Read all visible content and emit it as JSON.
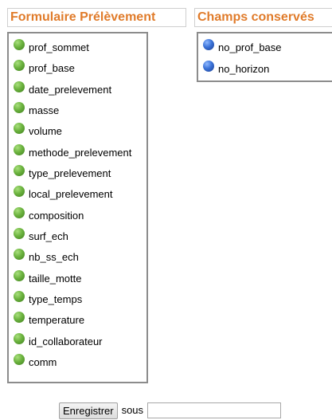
{
  "left_panel": {
    "title": "Formulaire Prélèvement",
    "fields": [
      {
        "label": "prof_sommet",
        "color": "#5ba53a"
      },
      {
        "label": "prof_base",
        "color": "#5ba53a"
      },
      {
        "label": "date_prelevement",
        "color": "#5ba53a"
      },
      {
        "label": "masse",
        "color": "#5ba53a"
      },
      {
        "label": "volume",
        "color": "#5ba53a"
      },
      {
        "label": "methode_prelevement",
        "color": "#5ba53a"
      },
      {
        "label": "type_prelevement",
        "color": "#5ba53a"
      },
      {
        "label": "local_prelevement",
        "color": "#5ba53a"
      },
      {
        "label": "composition",
        "color": "#5ba53a"
      },
      {
        "label": "surf_ech",
        "color": "#5ba53a"
      },
      {
        "label": "nb_ss_ech",
        "color": "#5ba53a"
      },
      {
        "label": "taille_motte",
        "color": "#5ba53a"
      },
      {
        "label": "type_temps",
        "color": "#5ba53a"
      },
      {
        "label": "temperature",
        "color": "#5ba53a"
      },
      {
        "label": "id_collaborateur",
        "color": "#5ba53a"
      },
      {
        "label": "comm",
        "color": "#5ba53a"
      }
    ]
  },
  "right_panel": {
    "title": "Champs conservés",
    "fields": [
      {
        "label": "no_prof_base",
        "color": "#2e63c9"
      },
      {
        "label": "no_horizon",
        "color": "#2e63c9"
      }
    ]
  },
  "save": {
    "button_label": "Enregistrer",
    "sous_label": "sous",
    "input_value": ""
  },
  "colors": {
    "title_accent": "#e07b2a",
    "box_border": "#8c8c8c",
    "dot_green": "#5ba53a",
    "dot_blue": "#2e63c9"
  }
}
